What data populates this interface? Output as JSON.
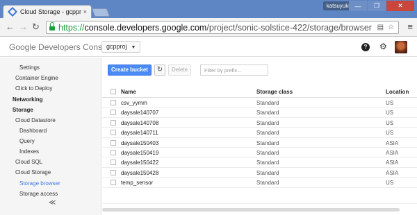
{
  "browser": {
    "tab_title": "Cloud Storage - gcpproj",
    "tab_close": "×",
    "user_name": "katsuyuki",
    "window_buttons": [
      "—",
      "❐",
      "✕"
    ],
    "url_scheme": "https://",
    "url_host": "console.developers.google.com",
    "url_path": "/project/sonic-solstice-422/storage/browser"
  },
  "header": {
    "brand_google": "Google",
    "brand_product": "Developers Console",
    "project_selector": "gcpproj",
    "help_icon_glyph": "?",
    "gear_icon_glyph": "⚙"
  },
  "sidebar": {
    "items": [
      {
        "label": "Settings",
        "level": 1
      },
      {
        "label": "Container Engine",
        "level": 0
      },
      {
        "label": "Click to Deploy",
        "level": 0
      },
      {
        "label": "Networking",
        "level": 0,
        "bold": true
      },
      {
        "label": "Storage",
        "level": 0,
        "bold": true
      },
      {
        "label": "Cloud Datastore",
        "level": 0
      },
      {
        "label": "Dashboard",
        "level": 1
      },
      {
        "label": "Query",
        "level": 1
      },
      {
        "label": "Indexes",
        "level": 1
      },
      {
        "label": "Cloud SQL",
        "level": 0
      },
      {
        "label": "Cloud Storage",
        "level": 0
      },
      {
        "label": "Storage browser",
        "level": 1,
        "active": true
      },
      {
        "label": "Storage access",
        "level": 1
      }
    ],
    "collapse_glyph": "≪"
  },
  "actions": {
    "create_label": "Create bucket",
    "refresh_glyph": "↻",
    "delete_label": "Delete",
    "filter_placeholder": "Filter by prefix..."
  },
  "table": {
    "headers": {
      "name": "Name",
      "class": "Storage class",
      "location": "Location"
    },
    "rows": [
      {
        "name": "csv_yymm",
        "class": "Standard",
        "location": "US"
      },
      {
        "name": "daysale140707",
        "class": "Standard",
        "location": "US"
      },
      {
        "name": "daysale140708",
        "class": "Standard",
        "location": "US"
      },
      {
        "name": "daysale140711",
        "class": "Standard",
        "location": "US"
      },
      {
        "name": "daysale150403",
        "class": "Standard",
        "location": "ASIA"
      },
      {
        "name": "daysale150419",
        "class": "Standard",
        "location": "ASIA"
      },
      {
        "name": "daysale150422",
        "class": "Standard",
        "location": "ASIA"
      },
      {
        "name": "daysale150428",
        "class": "Standard",
        "location": "ASIA"
      },
      {
        "name": "temp_sensor",
        "class": "Standard",
        "location": "US"
      }
    ]
  },
  "colors": {
    "accent": "#4a8af4",
    "active_link": "#3b78e7",
    "secure_green": "#1e9e3a"
  }
}
